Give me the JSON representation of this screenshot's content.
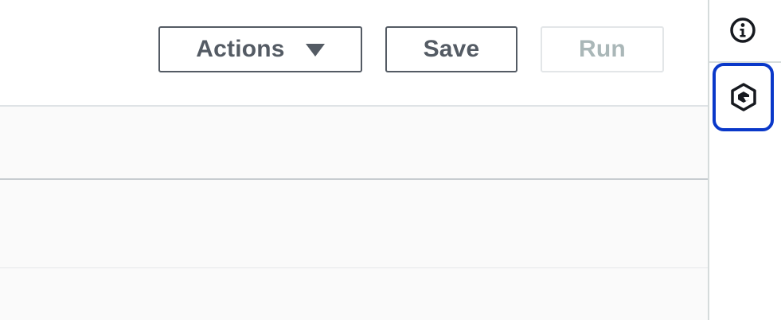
{
  "toolbar": {
    "actions_label": "Actions",
    "save_label": "Save",
    "run_label": "Run"
  },
  "icons": {
    "actions_caret": "caret-down-icon",
    "info": "info-icon",
    "hexagon": "hexagon-icon"
  },
  "colors": {
    "button_text": "#545b64",
    "disabled_text": "#aab7b8",
    "focus_ring": "#0a38c9",
    "panel_background": "#fafafa"
  }
}
